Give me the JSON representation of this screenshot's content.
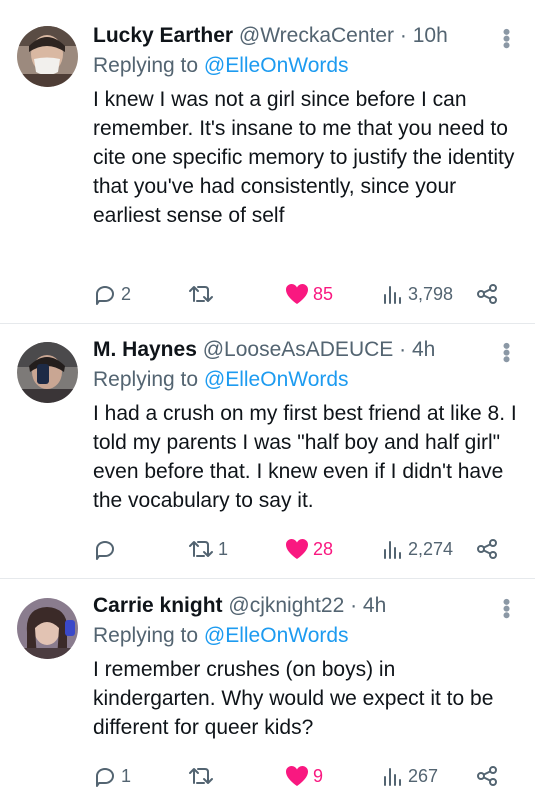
{
  "tweets": [
    {
      "name": "Lucky Earther",
      "handle": "@WreckaCenter",
      "time": "· 10h",
      "replying_prefix": "Replying to",
      "replying_to": "@ElleOnWords",
      "text": "I knew I was not a girl since before I can remember. It's insane to me that you need to cite one specific memory to justify the identity that you've had consistently, since your earliest sense of self",
      "replies": "2",
      "retweets": "",
      "likes": "85",
      "views": "3,798"
    },
    {
      "name": "M. Haynes",
      "handle": "@LooseAsADEUCE",
      "time": "· 4h",
      "replying_prefix": "Replying to",
      "replying_to": "@ElleOnWords",
      "text": "I had a crush on my first best friend at like 8. I told my parents I was \"half boy and half girl\" even before that. I knew even if I didn't have the vocabulary to say it.",
      "replies": "",
      "retweets": "1",
      "likes": "28",
      "views": "2,274"
    },
    {
      "name": "Carrie knight",
      "handle": "@cjknight22",
      "time": "· 4h",
      "replying_prefix": "Replying to",
      "replying_to": "@ElleOnWords",
      "text": "I remember crushes (on boys) in kindergarten. Why would we expect it to be different for queer kids?",
      "replies": "1",
      "retweets": "",
      "likes": "9",
      "views": "267"
    }
  ],
  "icons": {
    "reply": "reply-icon",
    "retweet": "retweet-icon",
    "like": "heart-icon",
    "views": "views-icon",
    "share": "share-icon",
    "more": "more-icon"
  },
  "colors": {
    "accent": "#1d9bf0",
    "like": "#f91880",
    "muted": "#536471"
  }
}
